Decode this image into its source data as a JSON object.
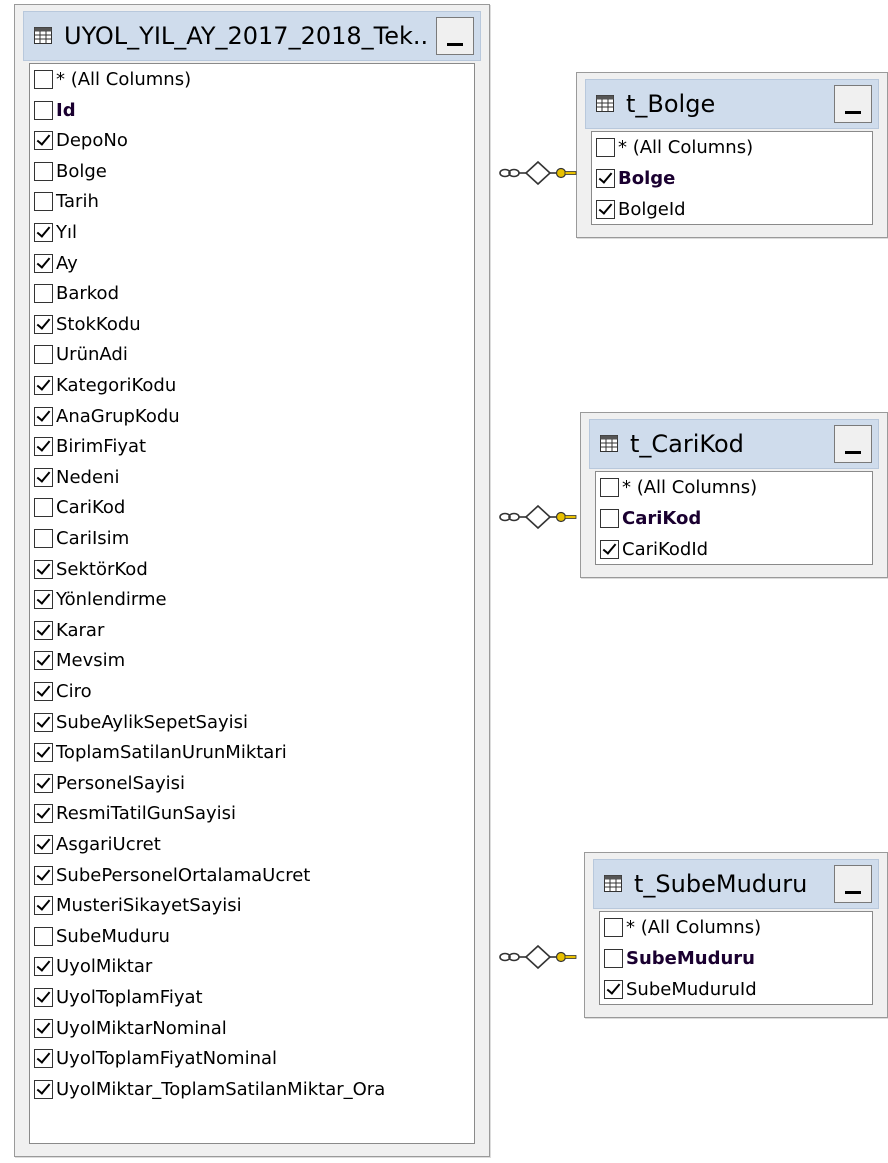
{
  "main_table": {
    "title": "UYOL_YIL_AY_2017_2018_Tek...",
    "columns": [
      {
        "name": "* (All Columns)",
        "checked": false,
        "key": false
      },
      {
        "name": "Id",
        "checked": false,
        "key": true
      },
      {
        "name": "DepoNo",
        "checked": true,
        "key": false
      },
      {
        "name": "Bolge",
        "checked": false,
        "key": false
      },
      {
        "name": "Tarih",
        "checked": false,
        "key": false
      },
      {
        "name": "Yıl",
        "checked": true,
        "key": false
      },
      {
        "name": "Ay",
        "checked": true,
        "key": false
      },
      {
        "name": "Barkod",
        "checked": false,
        "key": false
      },
      {
        "name": "StokKodu",
        "checked": true,
        "key": false
      },
      {
        "name": "UrünAdi",
        "checked": false,
        "key": false
      },
      {
        "name": "KategoriKodu",
        "checked": true,
        "key": false
      },
      {
        "name": "AnaGrupKodu",
        "checked": true,
        "key": false
      },
      {
        "name": "BirimFiyat",
        "checked": true,
        "key": false
      },
      {
        "name": "Nedeni",
        "checked": true,
        "key": false
      },
      {
        "name": "CariKod",
        "checked": false,
        "key": false
      },
      {
        "name": "CariIsim",
        "checked": false,
        "key": false
      },
      {
        "name": "SektörKod",
        "checked": true,
        "key": false
      },
      {
        "name": "Yönlendirme",
        "checked": true,
        "key": false
      },
      {
        "name": "Karar",
        "checked": true,
        "key": false
      },
      {
        "name": "Mevsim",
        "checked": true,
        "key": false
      },
      {
        "name": "Ciro",
        "checked": true,
        "key": false
      },
      {
        "name": "SubeAylikSepetSayisi",
        "checked": true,
        "key": false
      },
      {
        "name": "ToplamSatilanUrunMiktari",
        "checked": true,
        "key": false
      },
      {
        "name": "PersonelSayisi",
        "checked": true,
        "key": false
      },
      {
        "name": "ResmiTatilGunSayisi",
        "checked": true,
        "key": false
      },
      {
        "name": "AsgariUcret",
        "checked": true,
        "key": false
      },
      {
        "name": "SubePersonelOrtalamaUcret",
        "checked": true,
        "key": false
      },
      {
        "name": "MusteriSikayetSayisi",
        "checked": true,
        "key": false
      },
      {
        "name": "SubeMuduru",
        "checked": false,
        "key": false
      },
      {
        "name": "UyolMiktar",
        "checked": true,
        "key": false
      },
      {
        "name": "UyolToplamFiyat",
        "checked": true,
        "key": false
      },
      {
        "name": "UyolMiktarNominal",
        "checked": true,
        "key": false
      },
      {
        "name": "UyolToplamFiyatNominal",
        "checked": true,
        "key": false
      },
      {
        "name": "UyolMiktar_ToplamSatilanMiktar_Ora",
        "checked": true,
        "key": false
      }
    ]
  },
  "lookup_tables": [
    {
      "title": "t_Bolge",
      "columns": [
        {
          "name": "* (All Columns)",
          "checked": false,
          "key": false
        },
        {
          "name": "Bolge",
          "checked": true,
          "key": true
        },
        {
          "name": "BolgeId",
          "checked": true,
          "key": false
        }
      ]
    },
    {
      "title": "t_CariKod",
      "columns": [
        {
          "name": "* (All Columns)",
          "checked": false,
          "key": false
        },
        {
          "name": "CariKod",
          "checked": false,
          "key": true
        },
        {
          "name": "CariKodId",
          "checked": true,
          "key": false
        }
      ]
    },
    {
      "title": "t_SubeMuduru",
      "columns": [
        {
          "name": "* (All Columns)",
          "checked": false,
          "key": false
        },
        {
          "name": "SubeMuduru",
          "checked": false,
          "key": true
        },
        {
          "name": "SubeMuduruId",
          "checked": true,
          "key": false
        }
      ]
    }
  ],
  "colors": {
    "title_bar": "#cfdcec",
    "panel": "#f0f0f0",
    "key_icon": "#e8c000"
  },
  "icons": {
    "table": "table-grid-icon",
    "minimize": "minimize-icon",
    "relationship": "relationship-join-icon",
    "key": "key-icon"
  }
}
